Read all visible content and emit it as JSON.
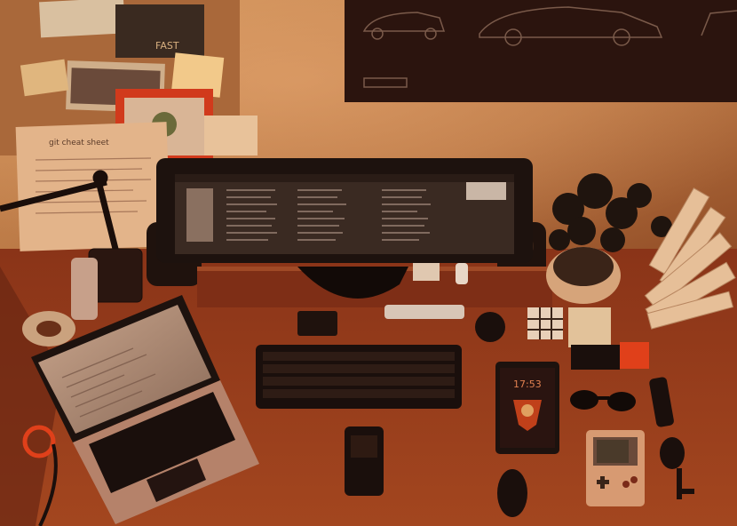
{
  "scene": {
    "description_colors": {
      "wall": "#c9864e",
      "wall_dark": "#7a3f1f",
      "desk": "#9a3e1e",
      "desk_dark": "#5c2210",
      "monitor_bezel": "#1d120e",
      "screen": "#3a2a22",
      "screen_text": "#a89080",
      "device_dark": "#1a0f0c",
      "accent_red": "#e0401a",
      "cork": "#a9683a",
      "paper": "#e8b78a",
      "plant": "#2a1a10",
      "gameboy": "#d79a72"
    }
  },
  "wall_items": {
    "cheat_sheet_title": "git cheat sheet",
    "sticker_text": "FAST"
  },
  "phone_tablet": {
    "clock": "17:53"
  }
}
